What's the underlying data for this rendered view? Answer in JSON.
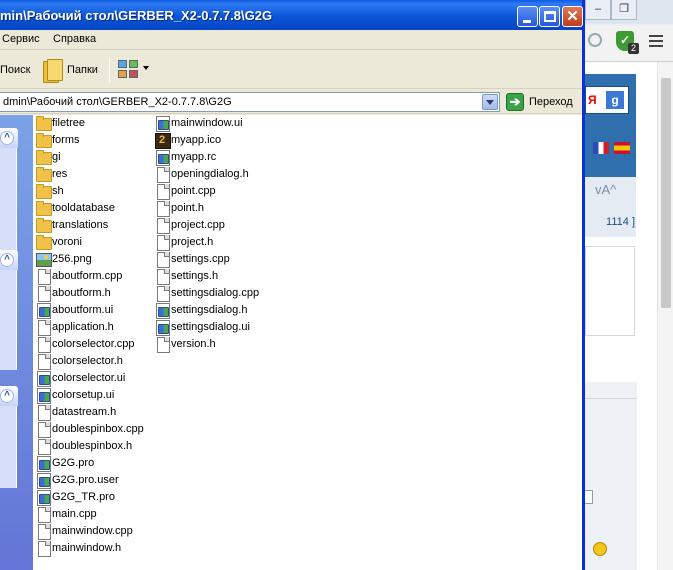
{
  "window": {
    "title": "min\\Рабочий стол\\GERBER_X2-0.7.7.8\\G2G",
    "close_glyph": "✕"
  },
  "menubar": {
    "items": [
      "Сервис",
      "Справка"
    ]
  },
  "toolbar": {
    "search_label": "Поиск",
    "folders_label": "Папки",
    "views_icon": "views-icon"
  },
  "address": {
    "value": "dmin\\Рабочий стол\\GERBER_X2-0.7.7.8\\G2G",
    "go_label": "Переход",
    "go_glyph": "➔"
  },
  "taskpane": {
    "chevron": "^"
  },
  "files": {
    "column1": [
      {
        "name": "filetree",
        "type": "folder"
      },
      {
        "name": "forms",
        "type": "folder"
      },
      {
        "name": "gi",
        "type": "folder"
      },
      {
        "name": "res",
        "type": "folder"
      },
      {
        "name": "sh",
        "type": "folder"
      },
      {
        "name": "tooldatabase",
        "type": "folder"
      },
      {
        "name": "translations",
        "type": "folder"
      },
      {
        "name": "voroni",
        "type": "folder"
      },
      {
        "name": "256.png",
        "type": "image"
      },
      {
        "name": "aboutform.cpp",
        "type": "doc"
      },
      {
        "name": "aboutform.h",
        "type": "doc"
      },
      {
        "name": "aboutform.ui",
        "type": "app"
      },
      {
        "name": "application.h",
        "type": "doc"
      },
      {
        "name": "colorselector.cpp",
        "type": "doc"
      },
      {
        "name": "colorselector.h",
        "type": "doc"
      },
      {
        "name": "colorselector.ui",
        "type": "app"
      },
      {
        "name": "colorsetup.ui",
        "type": "app"
      },
      {
        "name": "datastream.h",
        "type": "doc"
      },
      {
        "name": "doublespinbox.cpp",
        "type": "doc"
      },
      {
        "name": "doublespinbox.h",
        "type": "doc"
      },
      {
        "name": "G2G.pro",
        "type": "app"
      },
      {
        "name": "G2G.pro.user",
        "type": "app"
      },
      {
        "name": "G2G_TR.pro",
        "type": "app"
      },
      {
        "name": "main.cpp",
        "type": "doc"
      },
      {
        "name": "mainwindow.cpp",
        "type": "doc"
      },
      {
        "name": "mainwindow.h",
        "type": "doc"
      }
    ],
    "column2": [
      {
        "name": "mainwindow.ui",
        "type": "app"
      },
      {
        "name": "myapp.ico",
        "type": "ico"
      },
      {
        "name": "myapp.rc",
        "type": "app"
      },
      {
        "name": "openingdialog.h",
        "type": "doc"
      },
      {
        "name": "point.cpp",
        "type": "doc"
      },
      {
        "name": "point.h",
        "type": "doc"
      },
      {
        "name": "project.cpp",
        "type": "doc"
      },
      {
        "name": "project.h",
        "type": "doc"
      },
      {
        "name": "settings.cpp",
        "type": "doc"
      },
      {
        "name": "settings.h",
        "type": "doc"
      },
      {
        "name": "settingsdialog.cpp",
        "type": "doc"
      },
      {
        "name": "settingsdialog.h",
        "type": "app"
      },
      {
        "name": "settingsdialog.ui",
        "type": "app"
      },
      {
        "name": "version.h",
        "type": "doc"
      }
    ]
  },
  "browser": {
    "shield_count": "2",
    "yandex_glyph": "Я",
    "google_glyph": "g",
    "font_controls": "vA^",
    "counter_text": "1114 ]"
  }
}
